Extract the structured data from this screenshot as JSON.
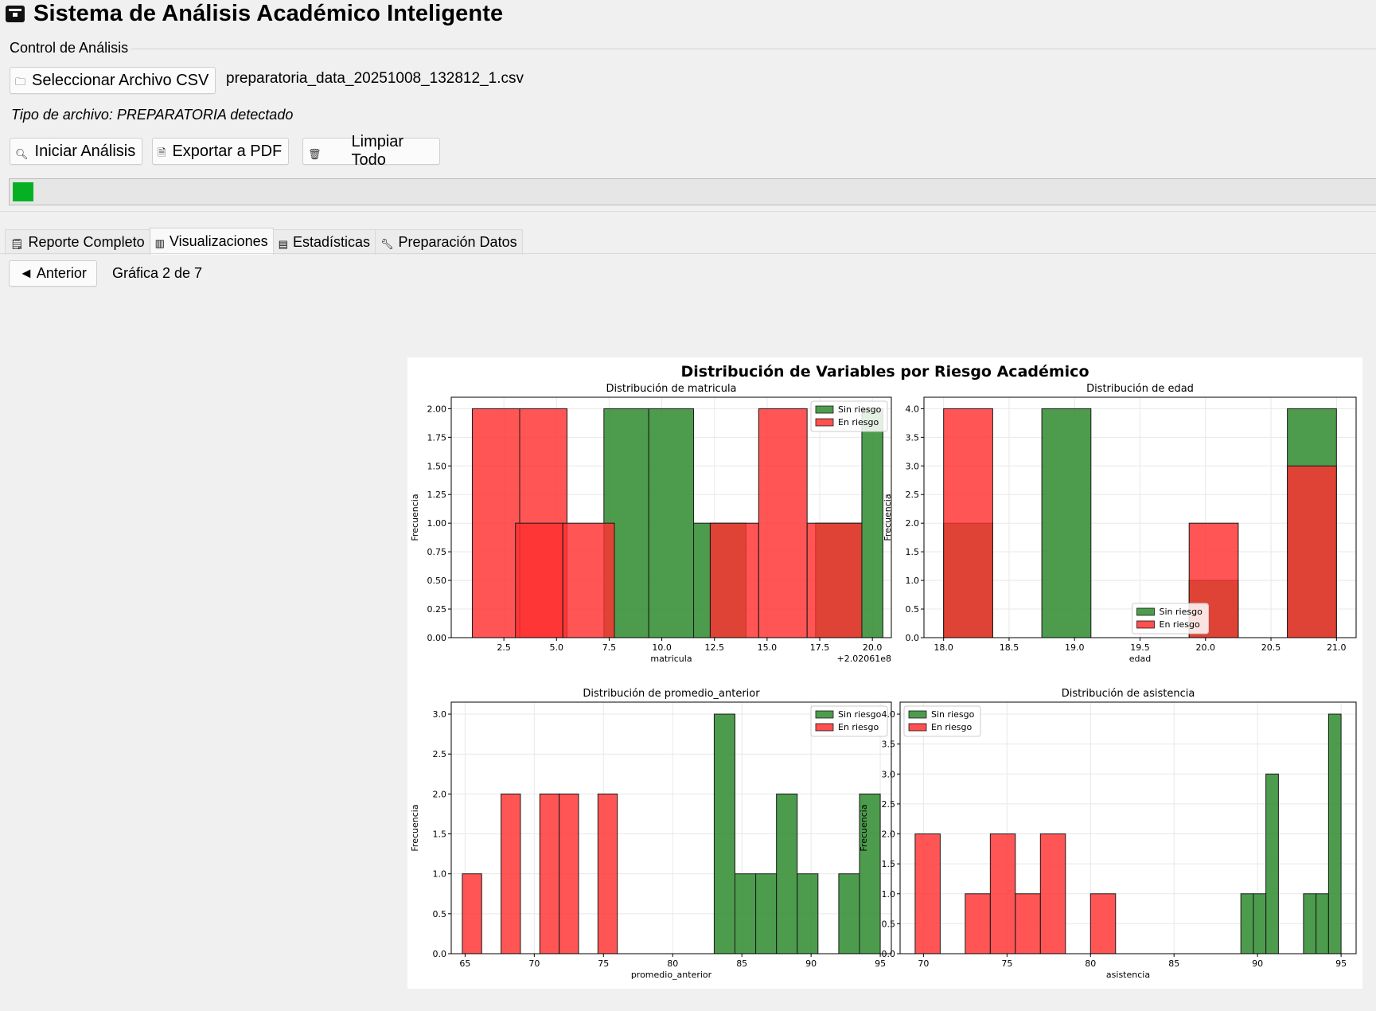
{
  "header": {
    "title": "Sistema de Análisis Académico Inteligente",
    "icon": "app-box-icon"
  },
  "control": {
    "group_label": "Control de Análisis",
    "select_csv_label": "Seleccionar Archivo CSV",
    "file_name": "preparatoria_data_20251008_132812_1.csv",
    "detected_text": "Tipo de archivo: PREPARATORIA detectado",
    "start_label": "Iniciar Análisis",
    "export_label": "Exportar a PDF",
    "clear_label": "Limpiar Todo",
    "progress": 0.015,
    "progress_color": "#06b025"
  },
  "tabs": [
    {
      "label": "Reporte Completo",
      "icon": "report-icon",
      "active": false
    },
    {
      "label": "Visualizaciones",
      "icon": "chart-icon",
      "active": true
    },
    {
      "label": "Estadísticas",
      "icon": "stats-icon",
      "active": false
    },
    {
      "label": "Preparación Datos",
      "icon": "wrench-icon",
      "active": false
    }
  ],
  "nav": {
    "prev_label": "◄ Anterior",
    "page_indicator": "Gráfica 2 de 7"
  },
  "colors": {
    "sin_riesgo": "#2e8b2e",
    "en_riesgo": "#ff3030"
  },
  "chart_data": {
    "title": "Distribución de Variables por Riesgo Académico",
    "legend_labels": [
      "Sin riesgo",
      "En riesgo"
    ],
    "subplots": [
      {
        "type": "histogram",
        "title": "Distribución de matricula",
        "xlabel": "matricula",
        "ylabel": "Frecuencia",
        "offset_text": "+2.02061e8",
        "xlim": [
          0,
          20.9
        ],
        "ylim": [
          0,
          2.1
        ],
        "xticks": [
          2.5,
          5.0,
          7.5,
          10.0,
          12.5,
          15.0,
          17.5,
          20.0
        ],
        "yticks": [
          0,
          0.25,
          0.5,
          0.75,
          1.0,
          1.25,
          1.5,
          1.75,
          2.0
        ],
        "tick_decimals": [
          1,
          2
        ],
        "legend": "top-right",
        "series": [
          {
            "name": "Sin riesgo",
            "bins": [
              [
                7.25,
                9.38,
                2
              ],
              [
                9.38,
                11.51,
                2
              ],
              [
                11.51,
                12.3,
                1
              ],
              [
                12.3,
                14.0,
                1
              ],
              [
                17.3,
                19.5,
                1
              ],
              [
                19.5,
                20.5,
                2
              ]
            ]
          },
          {
            "name": "En riesgo",
            "bins": [
              [
                1.0,
                3.25,
                2
              ],
              [
                3.25,
                5.5,
                2
              ],
              [
                3.05,
                5.3,
                1
              ],
              [
                5.3,
                7.75,
                1
              ],
              [
                12.3,
                14.6,
                1
              ],
              [
                14.6,
                16.9,
                2
              ],
              [
                16.9,
                19.5,
                1
              ]
            ]
          }
        ]
      },
      {
        "type": "histogram",
        "title": "Distribución de edad",
        "xlabel": "edad",
        "ylabel": "Frecuencia",
        "xlim": [
          17.85,
          21.15
        ],
        "ylim": [
          0,
          4.2
        ],
        "xticks": [
          18.0,
          18.5,
          19.0,
          19.5,
          20.0,
          20.5,
          21.0
        ],
        "yticks": [
          0,
          0.5,
          1.0,
          1.5,
          2.0,
          2.5,
          3.0,
          3.5,
          4.0
        ],
        "tick_decimals": [
          1,
          1
        ],
        "legend": "lower-center",
        "series": [
          {
            "name": "Sin riesgo",
            "bins": [
              [
                18.0,
                18.375,
                2
              ],
              [
                18.75,
                19.125,
                4
              ],
              [
                19.875,
                20.25,
                1
              ],
              [
                20.625,
                21.0,
                4
              ]
            ]
          },
          {
            "name": "En riesgo",
            "bins": [
              [
                18.0,
                18.375,
                4
              ],
              [
                19.875,
                20.25,
                2
              ],
              [
                20.625,
                21.0,
                3
              ]
            ]
          }
        ]
      },
      {
        "type": "histogram",
        "title": "Distribución de promedio_anterior",
        "xlabel": "promedio_anterior",
        "ylabel": "Frecuencia",
        "xlim": [
          64.0,
          95.8
        ],
        "ylim": [
          0,
          3.15
        ],
        "xticks": [
          65,
          70,
          75,
          80,
          85,
          90,
          95
        ],
        "yticks": [
          0,
          0.5,
          1.0,
          1.5,
          2.0,
          2.5,
          3.0
        ],
        "tick_decimals": [
          0,
          1
        ],
        "legend": "top-right",
        "series": [
          {
            "name": "Sin riesgo",
            "bins": [
              [
                83.0,
                84.5,
                3
              ],
              [
                84.5,
                86.0,
                1
              ],
              [
                86.0,
                87.5,
                1
              ],
              [
                87.5,
                89.0,
                2
              ],
              [
                89.0,
                90.5,
                1
              ],
              [
                92.0,
                93.5,
                1
              ],
              [
                93.5,
                95.0,
                2
              ]
            ]
          },
          {
            "name": "En riesgo",
            "bins": [
              [
                64.8,
                66.2,
                1
              ],
              [
                67.6,
                69.0,
                2
              ],
              [
                70.4,
                71.8,
                2
              ],
              [
                71.8,
                73.2,
                2
              ],
              [
                74.6,
                76.0,
                2
              ]
            ]
          }
        ]
      },
      {
        "type": "histogram",
        "title": "Distribución de asistencia",
        "xlabel": "asistencia",
        "ylabel": "Frecuencia",
        "xlim": [
          68.6,
          95.9
        ],
        "ylim": [
          0,
          4.2
        ],
        "xticks": [
          70,
          75,
          80,
          85,
          90,
          95
        ],
        "yticks": [
          0,
          0.5,
          1.0,
          1.5,
          2.0,
          2.5,
          3.0,
          3.5,
          4.0
        ],
        "tick_decimals": [
          0,
          1
        ],
        "legend": "top-left",
        "series": [
          {
            "name": "Sin riesgo",
            "bins": [
              [
                89.0,
                89.75,
                1
              ],
              [
                89.75,
                90.5,
                1
              ],
              [
                90.5,
                91.25,
                3
              ],
              [
                92.75,
                93.5,
                1
              ],
              [
                93.5,
                94.25,
                1
              ],
              [
                94.25,
                95.0,
                4
              ]
            ]
          },
          {
            "name": "En riesgo",
            "bins": [
              [
                69.5,
                71.0,
                2
              ],
              [
                72.5,
                74.0,
                1
              ],
              [
                74.0,
                75.5,
                2
              ],
              [
                75.5,
                77.0,
                1
              ],
              [
                77.0,
                78.5,
                2
              ],
              [
                80.0,
                81.5,
                1
              ]
            ]
          }
        ]
      }
    ]
  }
}
